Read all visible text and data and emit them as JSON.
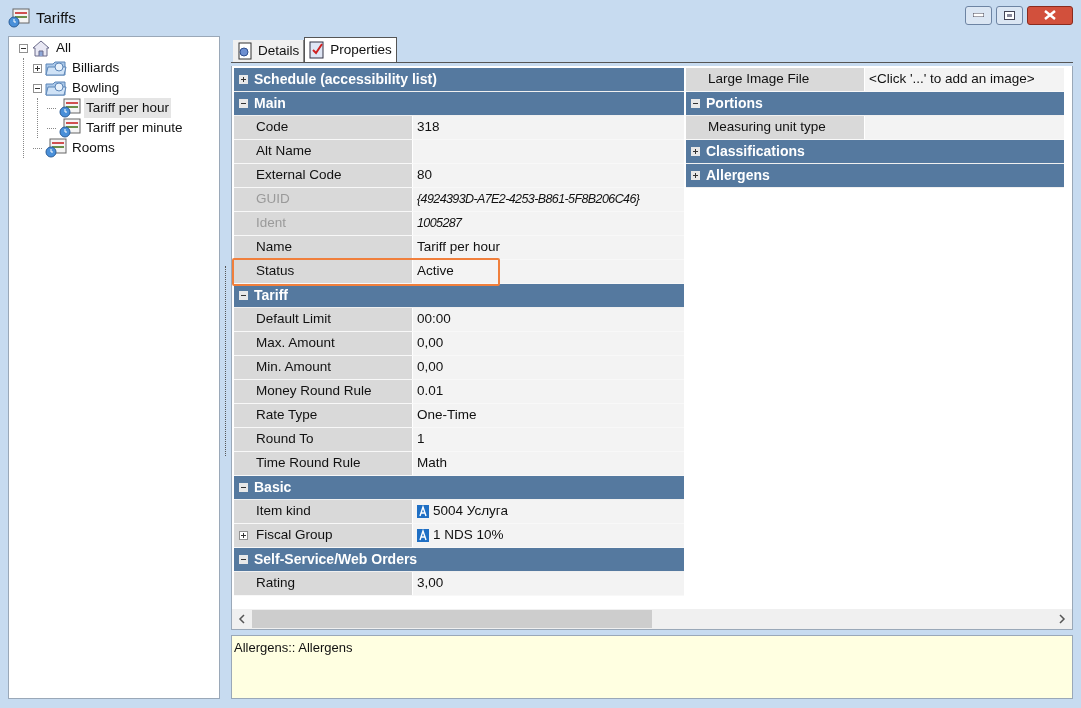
{
  "window": {
    "title": "Tariffs"
  },
  "tree": [
    {
      "label": "All",
      "kind": "root",
      "expanded": true,
      "selected": false,
      "children": [
        {
          "label": "Billiards",
          "kind": "folder",
          "expanded": false,
          "selected": false
        },
        {
          "label": "Bowling",
          "kind": "folder",
          "expanded": true,
          "selected": false,
          "children": [
            {
              "label": "Tariff per hour",
              "kind": "tariff",
              "selected": true
            },
            {
              "label": "Tariff per minute",
              "kind": "tariff",
              "selected": false
            }
          ]
        },
        {
          "label": "Rooms",
          "kind": "tariff",
          "selected": false
        }
      ]
    }
  ],
  "tabs": [
    {
      "label": "Details",
      "kind": "details",
      "selected": false
    },
    {
      "label": "Properties",
      "kind": "properties",
      "selected": true
    }
  ],
  "property_grid": {
    "left": [
      {
        "kind": "category",
        "label": "Schedule (accessibility list)",
        "expanded": false
      },
      {
        "kind": "category",
        "label": "Main",
        "expanded": true
      },
      {
        "kind": "property",
        "name": "Code",
        "value": "318",
        "disabled": false
      },
      {
        "kind": "property",
        "name": "Alt Name",
        "disabled": false
      },
      {
        "kind": "property",
        "name": "External Code",
        "value": "80",
        "disabled": false
      },
      {
        "kind": "property",
        "name": "GUID",
        "value": "{4924393D-A7E2-4253-B861-5F8B206C46}",
        "disabled": true
      },
      {
        "kind": "property",
        "name": "Ident",
        "value": "1005287",
        "disabled": true
      },
      {
        "kind": "property",
        "name": "Name",
        "value": "Tariff per hour",
        "disabled": false
      },
      {
        "kind": "property",
        "name": "Status",
        "value": "Active",
        "disabled": false,
        "highlighted": true
      },
      {
        "kind": "category",
        "label": "Tariff",
        "expanded": true
      },
      {
        "kind": "property",
        "name": "Default Limit",
        "value": "00:00",
        "disabled": false
      },
      {
        "kind": "property",
        "name": "Max. Amount",
        "value": "0,00",
        "disabled": false
      },
      {
        "kind": "property",
        "name": "Min. Amount",
        "value": "0,00",
        "disabled": false
      },
      {
        "kind": "property",
        "name": "Money Round Rule",
        "value": "0.01",
        "disabled": false
      },
      {
        "kind": "property",
        "name": "Rate Type",
        "value": "One-Time",
        "disabled": false
      },
      {
        "kind": "property",
        "name": "Round To",
        "value": "1",
        "disabled": false
      },
      {
        "kind": "property",
        "name": "Time Round Rule",
        "value": "Math",
        "disabled": false
      },
      {
        "kind": "category",
        "label": "Basic",
        "expanded": true
      },
      {
        "kind": "property",
        "name": "Item kind",
        "value": "5004 Услуга",
        "disabled": false,
        "linked": true
      },
      {
        "kind": "property",
        "name": "Fiscal Group",
        "value": "1 NDS 10%",
        "disabled": false,
        "linked": true,
        "expanded": false
      },
      {
        "kind": "category",
        "label": "Self-Service/Web Orders",
        "expanded": true
      },
      {
        "kind": "property",
        "name": "Rating",
        "value": "3,00",
        "disabled": false
      }
    ],
    "right": [
      {
        "kind": "property",
        "name": "Large Image File",
        "value": "<Click '...' to add an image>",
        "disabled": false
      },
      {
        "kind": "category",
        "label": "Portions",
        "expanded": true
      },
      {
        "kind": "property",
        "name": "Measuring unit type",
        "disabled": false
      },
      {
        "kind": "category",
        "label": "Classifications",
        "expanded": false
      },
      {
        "kind": "category",
        "label": "Allergens",
        "expanded": false
      }
    ]
  },
  "description": "Allergens:: Allergens"
}
